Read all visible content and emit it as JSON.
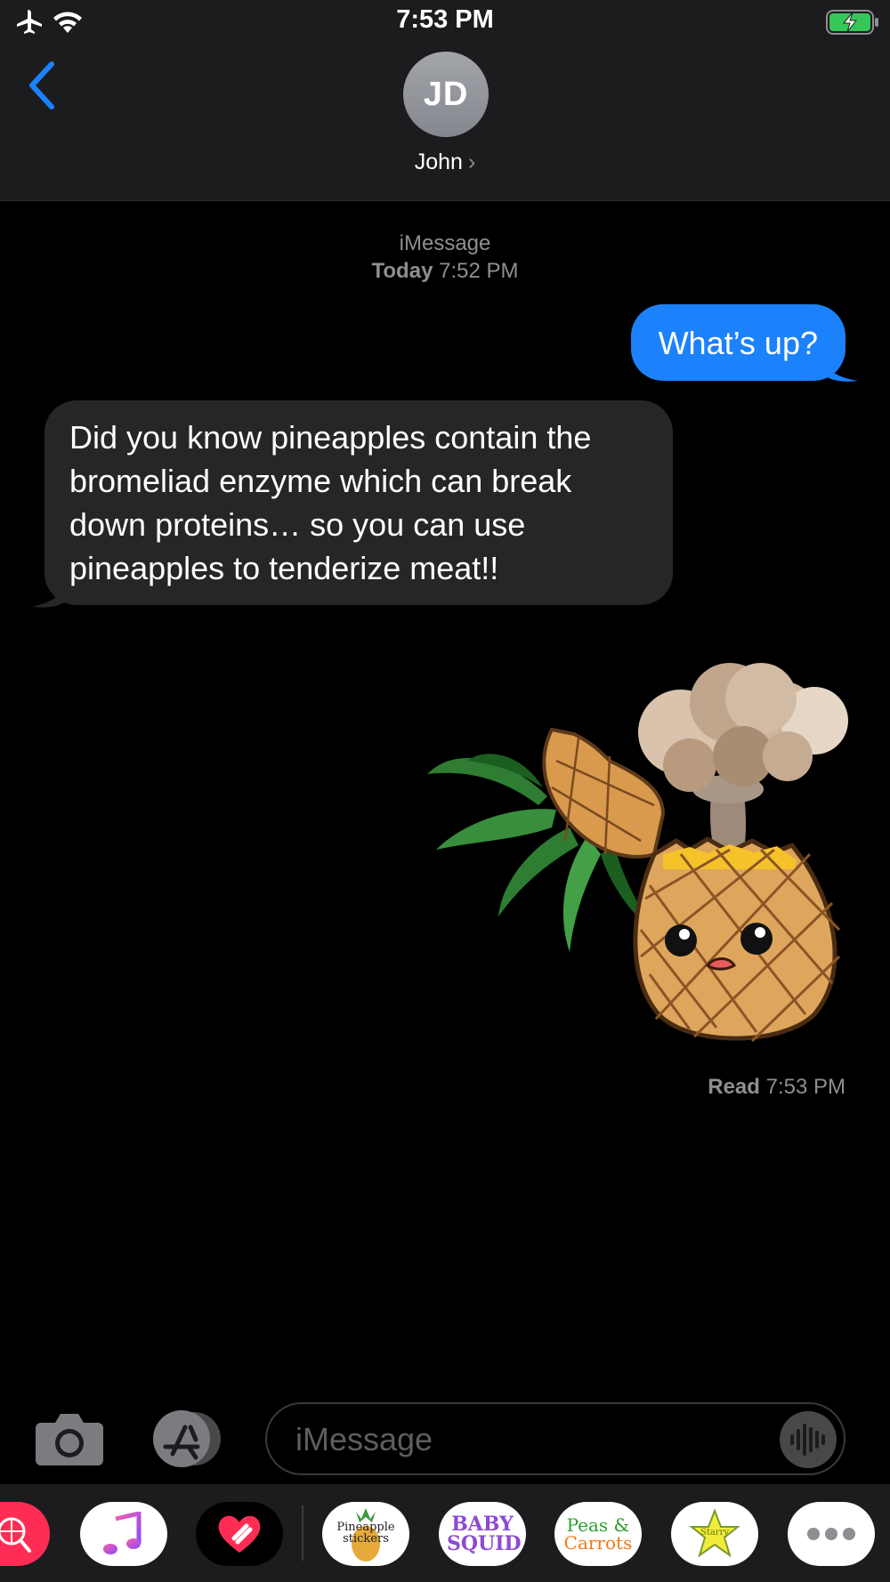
{
  "status_bar": {
    "time": "7:53 PM"
  },
  "header": {
    "avatar_initials": "JD",
    "contact_name": "John"
  },
  "conversation": {
    "service_label": "iMessage",
    "day": "Today",
    "timestamp": "7:52 PM",
    "messages": [
      {
        "direction": "outgoing",
        "text": "What’s up?"
      },
      {
        "direction": "incoming",
        "text": "Did you know pineapples contain the bromeliad enzyme which can break down proteins… so you can use pineapples to tenderize meat!!"
      },
      {
        "direction": "outgoing",
        "type": "sticker",
        "sticker": "exploding-pineapple"
      }
    ],
    "receipt_status": "Read",
    "receipt_time": "7:53 PM"
  },
  "compose": {
    "placeholder": "iMessage"
  },
  "app_drawer": {
    "apps": [
      {
        "name": "search-images",
        "color": "#ff2d55"
      },
      {
        "name": "music",
        "color": "#ffffff"
      },
      {
        "name": "digital-touch",
        "color": "#000000"
      },
      {
        "name": "pineapple-stickers",
        "label": "Pineapple stickers"
      },
      {
        "name": "baby-squid",
        "label": "BABY SQUID"
      },
      {
        "name": "peas-and-carrots",
        "label_top": "Peas &",
        "label_bottom": "Carrots"
      },
      {
        "name": "starry",
        "label": "Starry"
      },
      {
        "name": "more",
        "color": "#ffffff"
      }
    ]
  },
  "colors": {
    "accent": "#1b82fb",
    "incoming_bubble": "#262629",
    "battery": "#34c759"
  }
}
